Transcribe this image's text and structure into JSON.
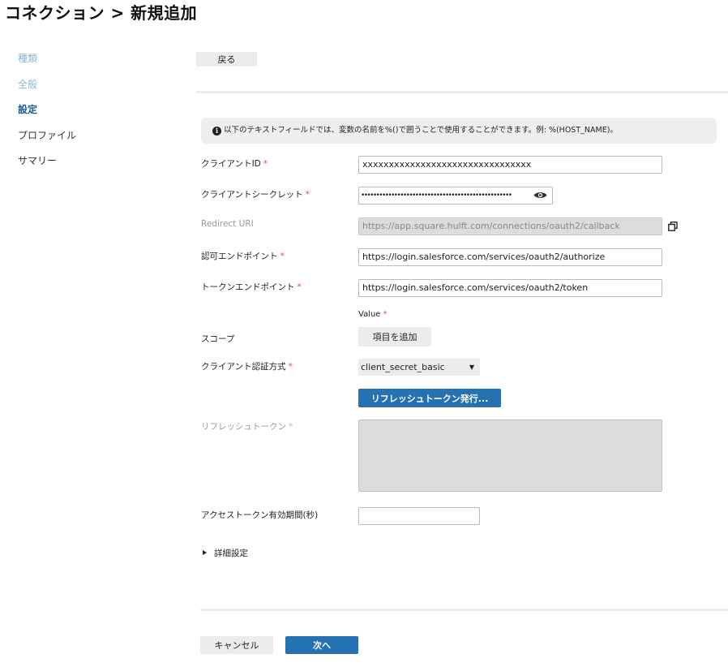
{
  "page_title": "コネクション > 新規追加",
  "sidebar": {
    "items": [
      {
        "label": "種類",
        "state": "done"
      },
      {
        "label": "全般",
        "state": "done"
      },
      {
        "label": "設定",
        "state": "active"
      },
      {
        "label": "プロファイル",
        "state": "todo"
      },
      {
        "label": "サマリー",
        "state": "todo"
      }
    ]
  },
  "toolbar": {
    "back_label": "戻る"
  },
  "info": {
    "text": "以下のテキストフィールドでは、変数の名前を%()で囲うことで使用することができます。例: %(HOST_NAME)。",
    "icon": "info-circle-icon"
  },
  "form": {
    "client_id": {
      "label": "クライアントID",
      "required": "*",
      "value": "xxxxxxxxxxxxxxxxxxxxxxxxxxxxxxxx"
    },
    "client_secret": {
      "label": "クライアントシークレット",
      "required": "*",
      "value": "••••••••••••••••••••••••••••••••••••••••••••••••••",
      "icon": "eye-icon"
    },
    "redirect_uri": {
      "label": "Redirect URI",
      "value": "https://app.square.hulft.com/connections/oauth2/callback",
      "icon": "copy-icon"
    },
    "auth_endpoint": {
      "label": "認可エンドポイント",
      "required": "*",
      "value": "https://login.salesforce.com/services/oauth2/authorize"
    },
    "token_endpoint": {
      "label": "トークンエンドポイント",
      "required": "*",
      "value": "https://login.salesforce.com/services/oauth2/token"
    },
    "scope": {
      "label": "スコープ",
      "value_header": "Value",
      "value_required": "*",
      "add_label": "項目を追加"
    },
    "client_auth": {
      "label": "クライアント認証方式",
      "required": "*",
      "selected": "client_secret_basic"
    },
    "refresh_button_label": "リフレッシュトークン発行...",
    "refresh_token": {
      "label": "リフレッシュトークン",
      "required": "*",
      "value": ""
    },
    "access_token_expiry": {
      "label": "アクセストークン有効期間(秒)",
      "value": ""
    },
    "advanced_label": "詳細設定"
  },
  "footer": {
    "cancel_label": "キャンセル",
    "next_label": "次へ"
  },
  "colors": {
    "primary": "#2572b2",
    "required": "#d9534f",
    "active_nav": "#1d5b8f",
    "done_nav": "#8fb4d4"
  }
}
